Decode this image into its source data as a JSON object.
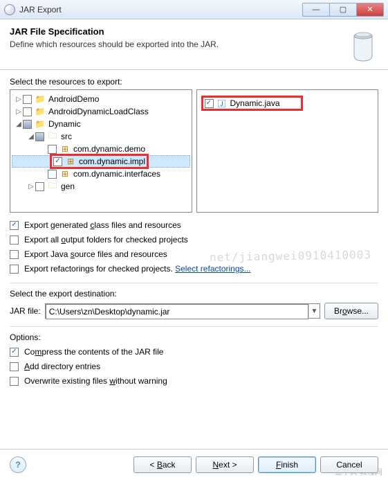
{
  "window": {
    "title": "JAR Export",
    "btn_min": "—",
    "btn_max": "▢",
    "btn_close": "✕"
  },
  "header": {
    "title": "JAR File Specification",
    "subtitle": "Define which resources should be exported into the JAR."
  },
  "resources": {
    "label": "Select the resources to export:",
    "tree": [
      {
        "depth": 0,
        "arrow": "▷",
        "checked": false,
        "filled": false,
        "icon": "proj",
        "label": "AndroidDemo"
      },
      {
        "depth": 0,
        "arrow": "▷",
        "checked": false,
        "filled": false,
        "icon": "proj",
        "label": "AndroidDynamicLoadClass"
      },
      {
        "depth": 0,
        "arrow": "◢",
        "checked": false,
        "filled": true,
        "icon": "proj",
        "label": "Dynamic"
      },
      {
        "depth": 1,
        "arrow": "◢",
        "checked": false,
        "filled": true,
        "icon": "fold",
        "label": "src"
      },
      {
        "depth": 2,
        "arrow": "",
        "checked": false,
        "filled": false,
        "icon": "pkg",
        "label": "com.dynamic.demo"
      },
      {
        "depth": 2,
        "arrow": "",
        "checked": true,
        "filled": false,
        "icon": "pkg",
        "label": "com.dynamic.impl",
        "selected": true,
        "redbox": true
      },
      {
        "depth": 2,
        "arrow": "",
        "checked": false,
        "filled": false,
        "icon": "pkg",
        "label": "com.dynamic.interfaces"
      },
      {
        "depth": 1,
        "arrow": "▷",
        "checked": false,
        "filled": false,
        "icon": "fold",
        "label": "gen"
      }
    ],
    "files": [
      {
        "checked": true,
        "icon": "java",
        "label": "Dynamic.java",
        "redbox": true
      }
    ]
  },
  "options_top": {
    "item1": {
      "checked": true,
      "pre": "Export generated ",
      "mn": "c",
      "post": "lass files and resources"
    },
    "item2": {
      "checked": false,
      "pre": "Export all ",
      "mn": "o",
      "post": "utput folders for checked projects"
    },
    "item3": {
      "checked": false,
      "pre": "Export Java ",
      "mn": "s",
      "post": "ource files and resources"
    },
    "item4": {
      "checked": false,
      "pre": "Export refactorin",
      "mn": "g",
      "post": "s for checked projects. ",
      "linktext": "Select refactorings..."
    }
  },
  "destination": {
    "label": "Select the export destination:",
    "field_label": "JAR file:",
    "value": "C:\\Users\\zn\\Desktop\\dynamic.jar",
    "browse_pre": "Br",
    "browse_mn": "o",
    "browse_post": "wse..."
  },
  "options_bottom": {
    "label": "Options:",
    "item1": {
      "checked": true,
      "pre": "Co",
      "mn": "m",
      "post": "press the contents of the JAR file"
    },
    "item2": {
      "checked": false,
      "mn": "A",
      "post": "dd directory entries"
    },
    "item3": {
      "checked": false,
      "pre": "Overwrite existing files ",
      "mn": "w",
      "post": "ithout warning"
    }
  },
  "footer": {
    "back_pre": "< ",
    "back_mn": "B",
    "back_post": "ack",
    "next_mn": "N",
    "next_post": "ext >",
    "finish_mn": "F",
    "finish_post": "inish",
    "cancel": "Cancel"
  },
  "watermarks": {
    "bg": "net/jiangwei0910410003",
    "corner": "查字典  教程网"
  }
}
